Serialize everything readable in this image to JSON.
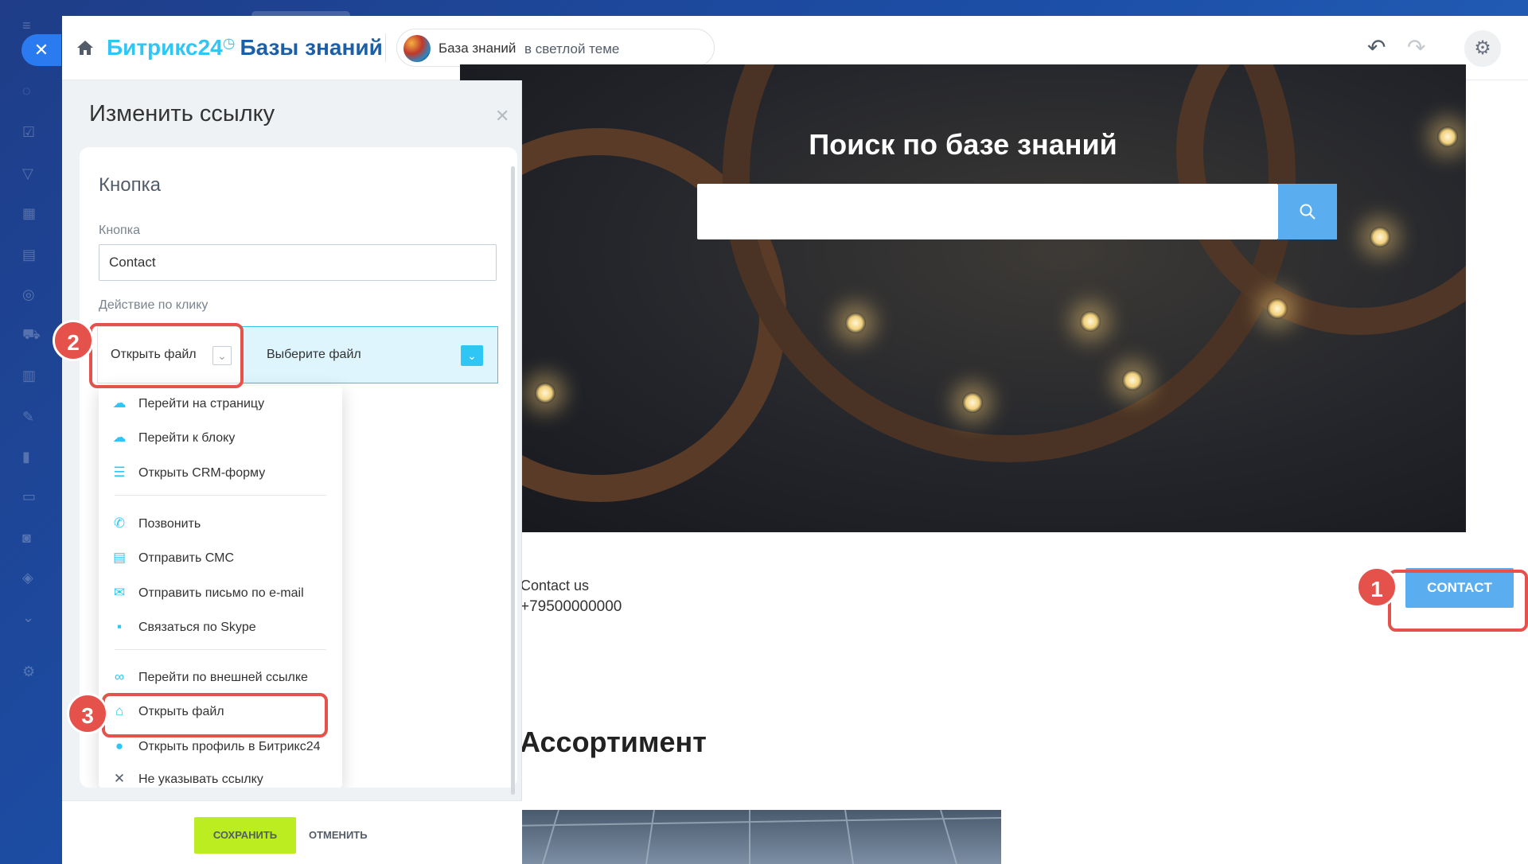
{
  "header": {
    "logo_brand": "Битрикс24",
    "logo_clock": "◷",
    "logo_section": "Базы знаний",
    "site_name": "База знаний",
    "site_theme": "в светлой теме"
  },
  "hero": {
    "title": "Поиск по базе знаний"
  },
  "contacts": {
    "line1": "Contact us",
    "line2": "+79500000000",
    "button": "CONTACT"
  },
  "section": {
    "heading": "Ассортимент"
  },
  "panel": {
    "title": "Изменить ссылку",
    "card_title": "Кнопка",
    "button_label": "Кнопка",
    "button_value": "Contact",
    "action_label": "Действие по клику",
    "action_selected": "Открыть файл",
    "file_select": "Выберите файл",
    "save": "СОХРАНИТЬ",
    "cancel": "ОТМЕНИТЬ"
  },
  "menu": {
    "items": [
      {
        "label": "Перейти на страницу",
        "icon": "page-link-icon"
      },
      {
        "label": "Перейти к блоку",
        "icon": "block-link-icon"
      },
      {
        "label": "Открыть CRM-форму",
        "icon": "crm-form-icon"
      },
      {
        "label": "Позвонить",
        "icon": "phone-icon"
      },
      {
        "label": "Отправить СМС",
        "icon": "sms-icon"
      },
      {
        "label": "Отправить письмо по e-mail",
        "icon": "email-icon"
      },
      {
        "label": "Связаться по Skype",
        "icon": "skype-icon"
      },
      {
        "label": "Перейти по внешней ссылке",
        "icon": "external-link-icon"
      },
      {
        "label": "Открыть файл",
        "icon": "file-icon"
      },
      {
        "label": "Открыть профиль в Битрикс24",
        "icon": "profile-icon"
      },
      {
        "label": "Не указывать ссылку",
        "icon": "no-link-icon"
      }
    ]
  },
  "annotations": {
    "badge1": "1",
    "badge2": "2",
    "badge3": "3"
  },
  "colors": {
    "accent": "#2fc6f6",
    "highlight": "#e5524b",
    "save": "#bbed21"
  }
}
